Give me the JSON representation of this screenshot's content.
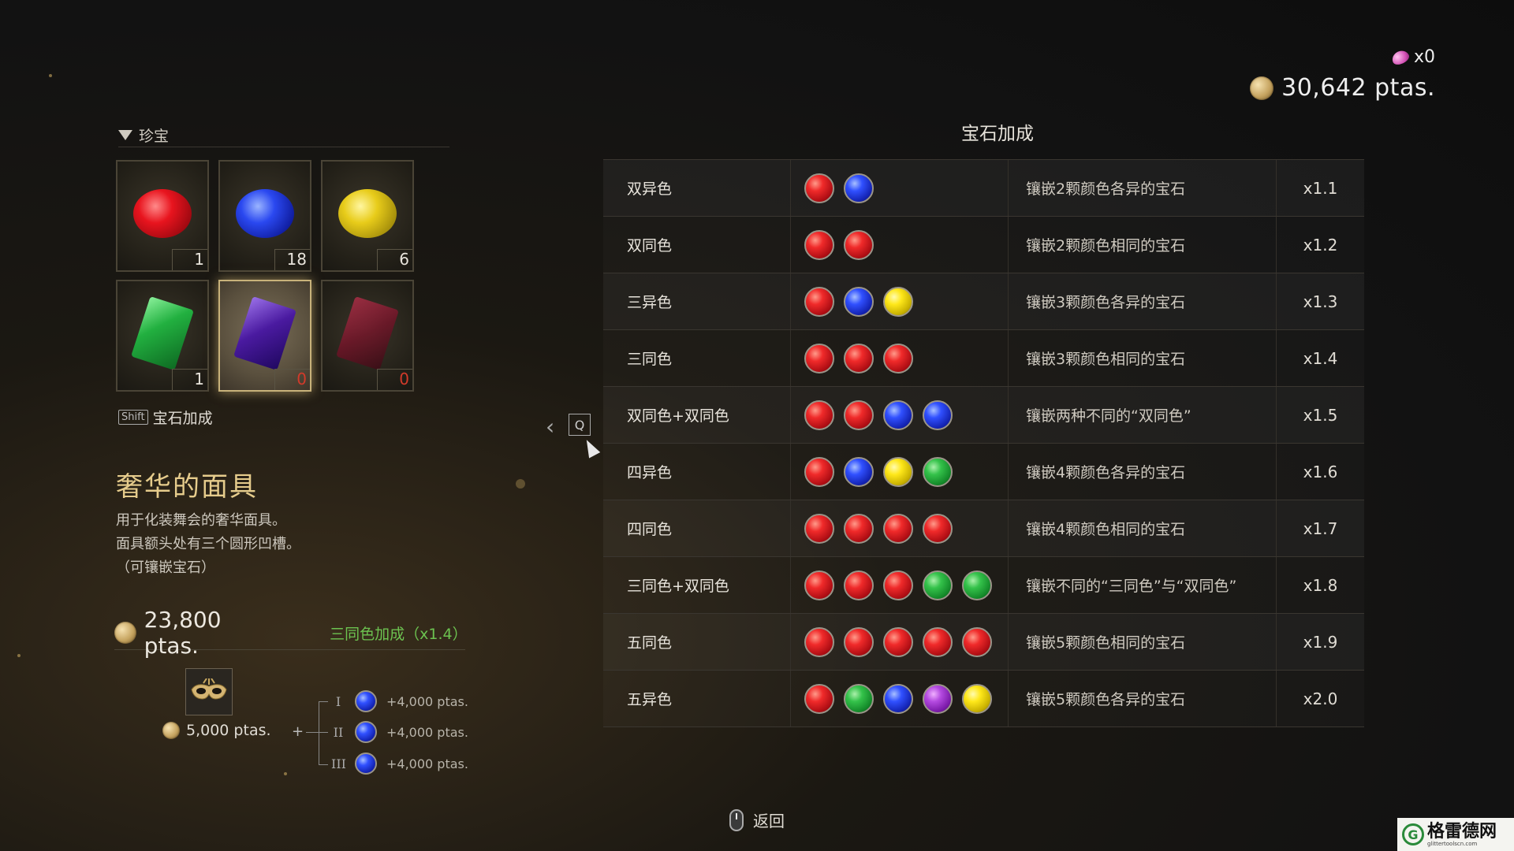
{
  "currency": {
    "shards": "x0",
    "money": "30,642 ptas."
  },
  "left": {
    "header": "珍宝",
    "slots": [
      {
        "gem": "red-oval",
        "count": "1",
        "zero": false,
        "selected": false
      },
      {
        "gem": "blue-oval",
        "count": "18",
        "zero": false,
        "selected": false
      },
      {
        "gem": "yellow-oval",
        "count": "6",
        "zero": false,
        "selected": false
      },
      {
        "gem": "green-rect",
        "count": "1",
        "zero": false,
        "selected": false
      },
      {
        "gem": "purple-rect",
        "count": "0",
        "zero": true,
        "selected": true
      },
      {
        "gem": "red-rect",
        "count": "0",
        "zero": true,
        "selected": false
      }
    ],
    "shift_key": "Shift",
    "shift_label": "宝石加成",
    "item_name": "奢华的面具",
    "desc": [
      "用于化装舞会的奢华面具。",
      "面具额头处有三个圆形凹槽。",
      "（可镶嵌宝石）"
    ],
    "price": "23,800 ptas.",
    "bonus": "三同色加成（x1.4）",
    "base_price": "5,000 ptas.",
    "plus": "+",
    "sockets": [
      {
        "roman": "I",
        "value": "+4,000 ptas."
      },
      {
        "roman": "II",
        "value": "+4,000 ptas."
      },
      {
        "roman": "III",
        "value": "+4,000 ptas."
      }
    ]
  },
  "nav": {
    "arrow": "‹",
    "key": "Q"
  },
  "table": {
    "title": "宝石加成",
    "rows": [
      {
        "name": "双异色",
        "dots": [
          "red",
          "blue"
        ],
        "desc": "镶嵌2颗颜色各异的宝石",
        "mult": "x1.1"
      },
      {
        "name": "双同色",
        "dots": [
          "red",
          "red"
        ],
        "desc": "镶嵌2颗颜色相同的宝石",
        "mult": "x1.2"
      },
      {
        "name": "三异色",
        "dots": [
          "red",
          "blue",
          "yellow"
        ],
        "desc": "镶嵌3颗颜色各异的宝石",
        "mult": "x1.3"
      },
      {
        "name": "三同色",
        "dots": [
          "red",
          "red",
          "red"
        ],
        "desc": "镶嵌3颗颜色相同的宝石",
        "mult": "x1.4"
      },
      {
        "name": "双同色+双同色",
        "dots": [
          "red",
          "red",
          "blue",
          "blue"
        ],
        "desc": "镶嵌两种不同的“双同色”",
        "mult": "x1.5"
      },
      {
        "name": "四异色",
        "dots": [
          "red",
          "blue",
          "yellow",
          "green"
        ],
        "desc": "镶嵌4颗颜色各异的宝石",
        "mult": "x1.6"
      },
      {
        "name": "四同色",
        "dots": [
          "red",
          "red",
          "red",
          "red"
        ],
        "desc": "镶嵌4颗颜色相同的宝石",
        "mult": "x1.7"
      },
      {
        "name": "三同色+双同色",
        "dots": [
          "red",
          "red",
          "red",
          "green",
          "green"
        ],
        "desc": "镶嵌不同的“三同色”与“双同色”",
        "mult": "x1.8"
      },
      {
        "name": "五同色",
        "dots": [
          "red",
          "red",
          "red",
          "red",
          "red"
        ],
        "desc": "镶嵌5颗颜色相同的宝石",
        "mult": "x1.9"
      },
      {
        "name": "五异色",
        "dots": [
          "red",
          "green",
          "blue",
          "purple",
          "yellow"
        ],
        "desc": "镶嵌5颗颜色各异的宝石",
        "mult": "x2.0"
      }
    ]
  },
  "footer": {
    "back": "返回"
  },
  "watermark": {
    "main": "格雷德网",
    "sub": "glittertoolscn.com",
    "logo": "G"
  },
  "colors": {
    "gold_title": "#e6cc8c",
    "bonus_green": "#6cc250",
    "zero_red": "#d23a2a"
  }
}
